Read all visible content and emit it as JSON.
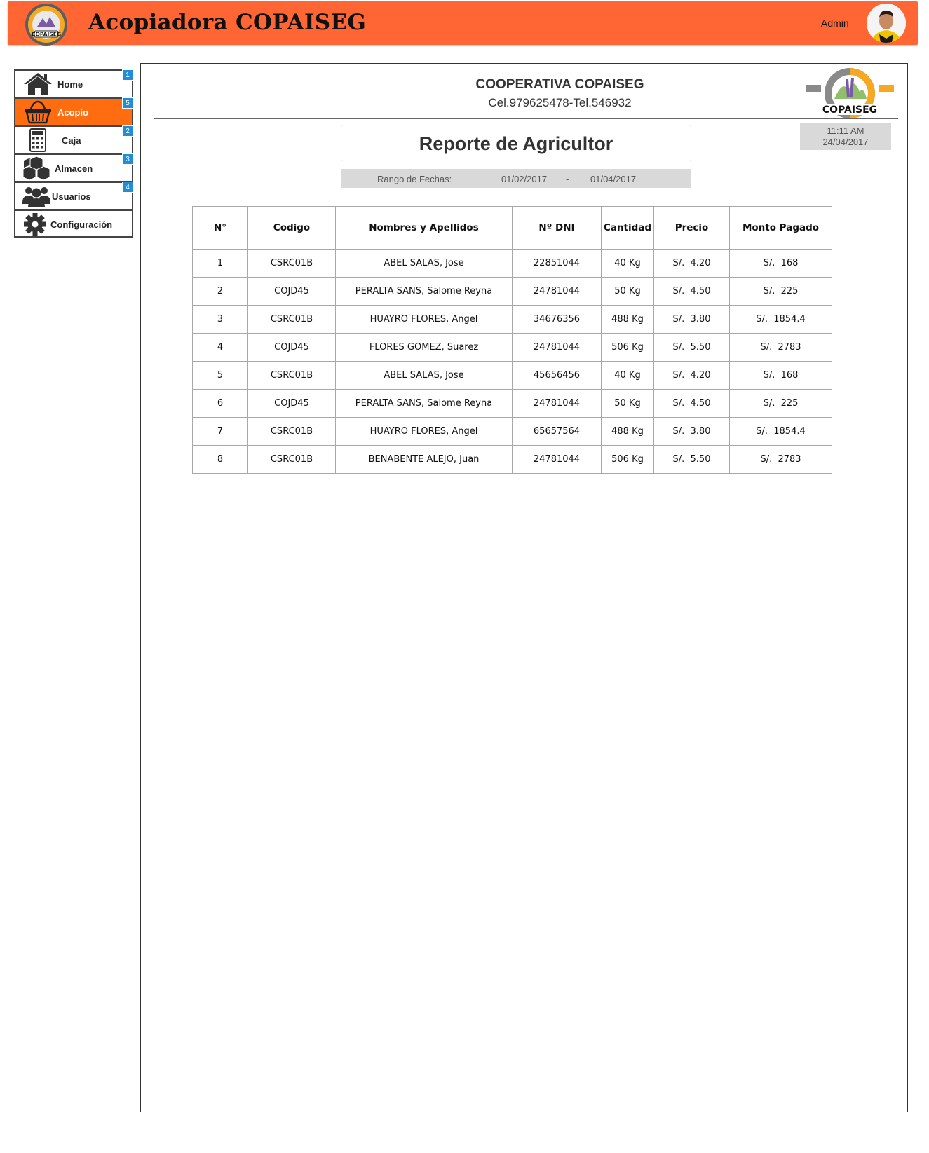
{
  "header": {
    "title": "Acopiadora COPAISEG",
    "user_label": "Admin",
    "logo_text": "COPAISEG"
  },
  "sidebar": {
    "items": [
      {
        "label": "Home",
        "badge": "1",
        "icon": "home-icon"
      },
      {
        "label": "Acopio",
        "badge": "5",
        "icon": "basket-icon",
        "active": true
      },
      {
        "label": "Caja",
        "badge": "2",
        "icon": "calculator-icon"
      },
      {
        "label": "Almacen",
        "badge": "3",
        "icon": "boxes-icon"
      },
      {
        "label": "Usuarios",
        "badge": "4",
        "icon": "users-icon"
      },
      {
        "label": "Configuración",
        "badge": "",
        "icon": "gear-icon"
      }
    ]
  },
  "report": {
    "coop_name": "COOPERATIVA COPAISEG",
    "phones": "Cel.979625478-Tel.546932",
    "logo_text": "COPAISEG",
    "time": "11:11 AM",
    "date": "24/04/2017",
    "title": "Reporte de Agricultor",
    "range_label": "Rango de Fechas:",
    "date_from": "01/02/2017",
    "separator": "-",
    "date_to": "01/04/2017"
  },
  "table": {
    "columns": [
      "N°",
      "Codigo",
      "Nombres y Apellidos",
      "Nº DNI",
      "Cantidad",
      "Precio",
      "Monto Pagado"
    ],
    "rows": [
      [
        "1",
        "CSRC01B",
        "ABEL SALAS, Jose",
        "22851044",
        "40 Kg",
        "S/.  4.20",
        "S/.  168"
      ],
      [
        "2",
        "COJD45",
        "PERALTA SANS, Salome Reyna",
        "24781044",
        "50 Kg",
        "S/.  4.50",
        "S/.  225"
      ],
      [
        "3",
        "CSRC01B",
        "HUAYRO FLORES, Angel",
        "34676356",
        "488 Kg",
        "S/.  3.80",
        "S/.  1854.4"
      ],
      [
        "4",
        "COJD45",
        "FLORES GOMEZ, Suarez",
        "24781044",
        "506 Kg",
        "S/.  5.50",
        "S/.  2783"
      ],
      [
        "5",
        "CSRC01B",
        "ABEL SALAS, Jose",
        "45656456",
        "40 Kg",
        "S/.  4.20",
        "S/.  168"
      ],
      [
        "6",
        "COJD45",
        "PERALTA SANS, Salome Reyna",
        "24781044",
        "50 Kg",
        "S/.  4.50",
        "S/.  225"
      ],
      [
        "7",
        "CSRC01B",
        "HUAYRO FLORES, Angel",
        "65657564",
        "488 Kg",
        "S/.  3.80",
        "S/.  1854.4"
      ],
      [
        "8",
        "CSRC01B",
        "BENABENTE ALEJO, Juan",
        "24781044",
        "506 Kg",
        "S/.  5.50",
        "S/.  2783"
      ]
    ]
  },
  "colors": {
    "header_bg": "#ff6633",
    "active_item": "#ff6d10",
    "badge": "#1e8fd6",
    "gray_box": "#d9d9d9"
  }
}
